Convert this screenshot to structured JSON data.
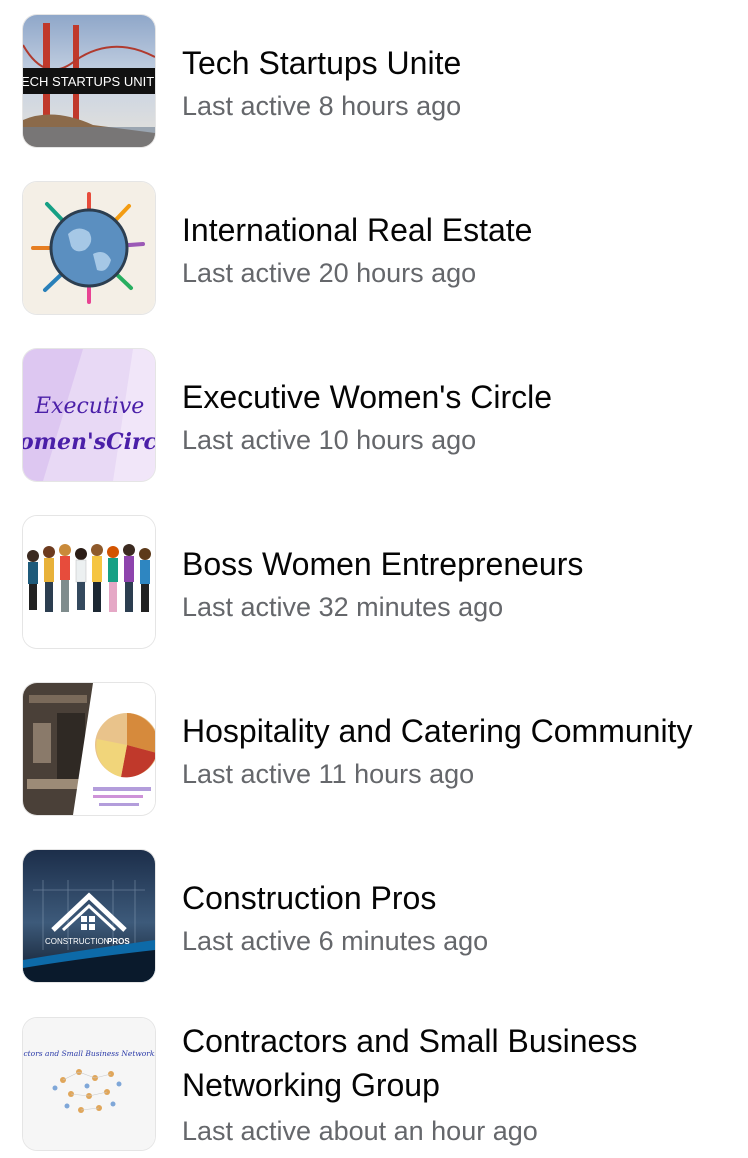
{
  "groups": [
    {
      "name": "Tech Startups Unite",
      "last_active": "Last active 8 hours ago",
      "thumb_text": "ECH STARTUPS UNIT",
      "icon": "golden-gate-bridge-thumbnail"
    },
    {
      "name": "International Real Estate",
      "last_active": "Last active 20 hours ago",
      "icon": "globe-landmarks-thumbnail"
    },
    {
      "name": "Executive Women's Circle",
      "last_active": "Last active 10 hours ago",
      "thumb_text_1": "Executive",
      "thumb_text_2": "omen'sCirci",
      "icon": "script-lettering-thumbnail"
    },
    {
      "name": "Boss Women Entrepreneurs",
      "last_active": "Last active 32 minutes ago",
      "icon": "women-group-thumbnail"
    },
    {
      "name": "Hospitality and Catering Community",
      "last_active": "Last active 11 hours ago",
      "icon": "kitchen-food-thumbnail"
    },
    {
      "name": "Construction Pros",
      "last_active": "Last active 6 minutes ago",
      "thumb_text_1": "CONSTRUCTION",
      "thumb_text_2": "PROS",
      "icon": "house-logo-thumbnail"
    },
    {
      "name": "Contractors and Small Business Networking Group",
      "last_active": "Last active about an hour ago",
      "thumb_text": "actors and Small Business Networking",
      "icon": "network-map-thumbnail"
    }
  ],
  "colors": {
    "title": "#050505",
    "meta": "#65676b"
  }
}
